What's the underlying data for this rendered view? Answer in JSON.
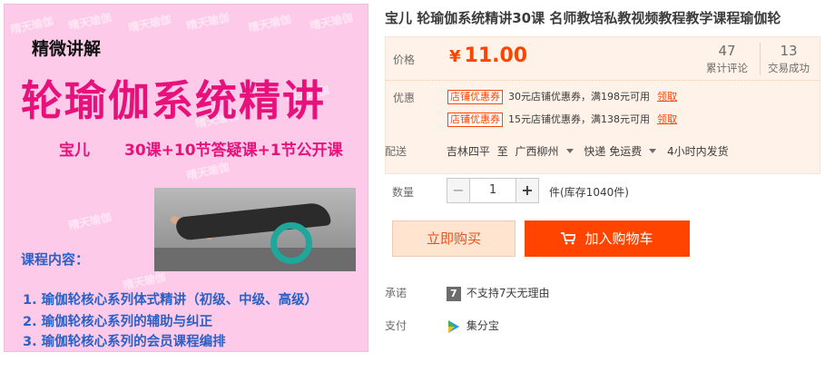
{
  "promo": {
    "watermark": "晴天瑜伽",
    "subtitle": "精微讲解",
    "title": "轮瑜伽系统精讲",
    "author": "宝儿",
    "courses": "30课+10节答疑课+1节公开课",
    "content_title": "课程内容：",
    "lines": [
      "1. 瑜伽轮核心系列体式精讲（初级、中级、高级）",
      "2. 瑜伽轮核心系列的辅助与纠正",
      "3. 瑜伽轮核心系列的会员课程编排"
    ]
  },
  "product": {
    "title": "宝儿 轮瑜伽系统精讲30课 名师教培私教视频教程教学课程瑜伽轮"
  },
  "price": {
    "label": "价格",
    "currency": "¥",
    "amount": "11.00",
    "reviews_count": "47",
    "reviews_label": "累计评论",
    "deals_count": "13",
    "deals_label": "交易成功"
  },
  "promotion": {
    "label": "优惠",
    "coupons": [
      {
        "tag": "店铺优惠券",
        "desc": "30元店铺优惠券，满198元可用",
        "action": "领取"
      },
      {
        "tag": "店铺优惠券",
        "desc": "15元店铺优惠券，满138元可用",
        "action": "领取"
      }
    ]
  },
  "shipping": {
    "label": "配送",
    "from": "吉林四平",
    "to_word": "至",
    "destination": "广西柳州",
    "method": "快递 免运费",
    "dispatch": "4小时内发货"
  },
  "quantity": {
    "label": "数量",
    "minus": "−",
    "value": "1",
    "plus": "+",
    "stock": "件(库存1040件)"
  },
  "actions": {
    "buy_now": "立即购买",
    "add_to_cart": "加入购物车"
  },
  "promise": {
    "label": "承诺",
    "badge": "7",
    "text": "不支持7天无理由"
  },
  "payment": {
    "label": "支付",
    "method": "集分宝"
  },
  "colors": {
    "accent": "#ff4400",
    "promo_bg": "#fdcbe9",
    "promo_magenta": "#e8107a",
    "promo_blue": "#2b60c6",
    "price_bg": "#fff2e8"
  }
}
